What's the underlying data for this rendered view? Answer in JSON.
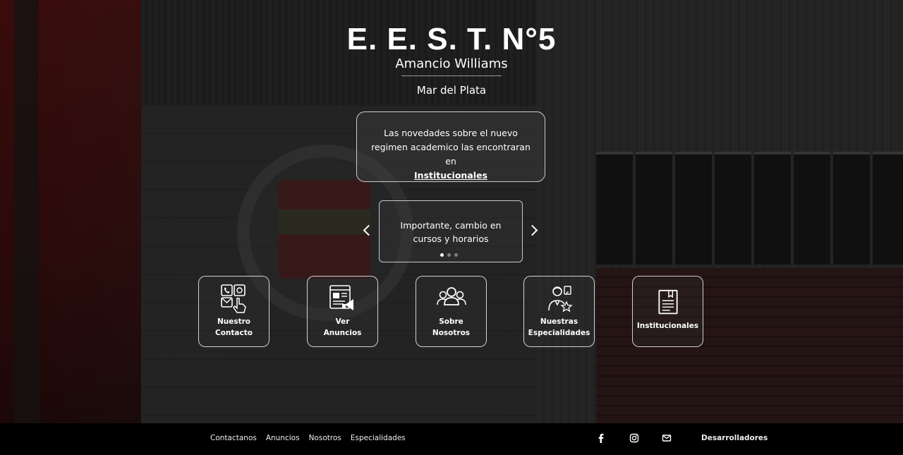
{
  "header": {
    "title": "E. E. S. T. N°5",
    "subtitle": "Amancio Williams",
    "city": "Mar del Plata"
  },
  "notice": {
    "text": "Las novedades sobre el nuevo regimen academico las encontraran en",
    "link_label": "Institucionales"
  },
  "carousel": {
    "slide_text_line1": "Importante, cambio en",
    "slide_text_line2": "cursos y horarios",
    "slide_count": 3,
    "active_index": 0
  },
  "tiles": [
    {
      "line1": "Nuestro",
      "line2": "Contacto",
      "icon": "contact-icon"
    },
    {
      "line1": "Ver",
      "line2": "Anuncios",
      "icon": "announcements-icon"
    },
    {
      "line1": "Sobre",
      "line2": "Nosotros",
      "icon": "people-icon"
    },
    {
      "line1": "Nuestras",
      "line2": "Especialidades",
      "icon": "specialties-icon"
    },
    {
      "line1": "Institucionales",
      "icon": "document-icon"
    }
  ],
  "footer": {
    "links": [
      "Contactanos",
      "Anuncios",
      "Nosotros",
      "Especialidades"
    ],
    "social": [
      "facebook-icon",
      "instagram-icon",
      "mail-icon"
    ],
    "developers_label": "Desarrolladores"
  },
  "colors": {
    "text": "#ffffff",
    "footer_bg": "#000000",
    "accent_red": "#7a1a1a"
  }
}
